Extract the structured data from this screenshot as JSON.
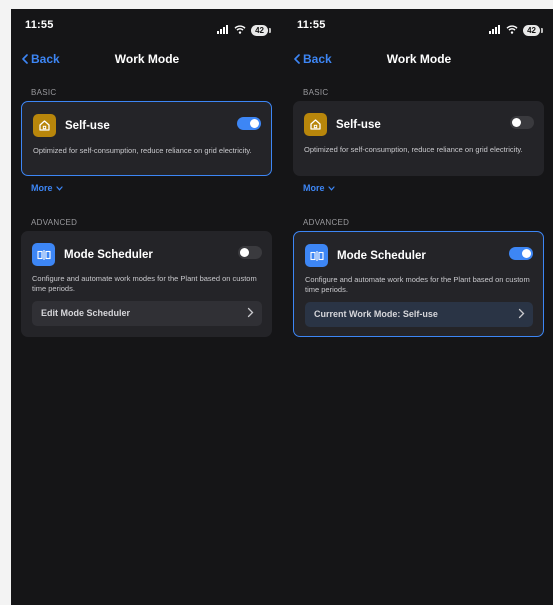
{
  "screens": [
    {
      "status": {
        "time": "11:55",
        "battery": "42"
      },
      "nav": {
        "back_label": "Back",
        "title": "Work Mode"
      },
      "basic": {
        "section_label": "BASIC",
        "self_use": {
          "title": "Self-use",
          "description": "Optimized for self-consumption, reduce reliance on grid electricity.",
          "toggle_on": true,
          "selected": true
        },
        "more_label": "More"
      },
      "advanced": {
        "section_label": "ADVANCED",
        "scheduler": {
          "title": "Mode Scheduler",
          "description": "Configure and automate work modes for the Plant based on custom time periods.",
          "toggle_on": false,
          "selected": false,
          "action_label": "Edit Mode Scheduler"
        }
      }
    },
    {
      "status": {
        "time": "11:55",
        "battery": "42"
      },
      "nav": {
        "back_label": "Back",
        "title": "Work Mode"
      },
      "basic": {
        "section_label": "BASIC",
        "self_use": {
          "title": "Self-use",
          "description": "Optimized for self-consumption, reduce reliance on grid electricity.",
          "toggle_on": false,
          "selected": false
        },
        "more_label": "More"
      },
      "advanced": {
        "section_label": "ADVANCED",
        "scheduler": {
          "title": "Mode Scheduler",
          "description": "Configure and automate work modes for the Plant based on custom time periods.",
          "toggle_on": true,
          "selected": true,
          "action_label": "Current Work Mode: Self-use"
        }
      }
    }
  ],
  "colors": {
    "accent": "#3d86f5",
    "self_use_icon_bg": "#b8860b",
    "background": "#151517",
    "card": "#242428"
  },
  "icons": [
    "signal-icon",
    "wifi-icon",
    "battery-icon",
    "back-chevron-icon",
    "house-icon",
    "scheduler-icon",
    "chevron-down-icon",
    "chevron-right-icon"
  ]
}
